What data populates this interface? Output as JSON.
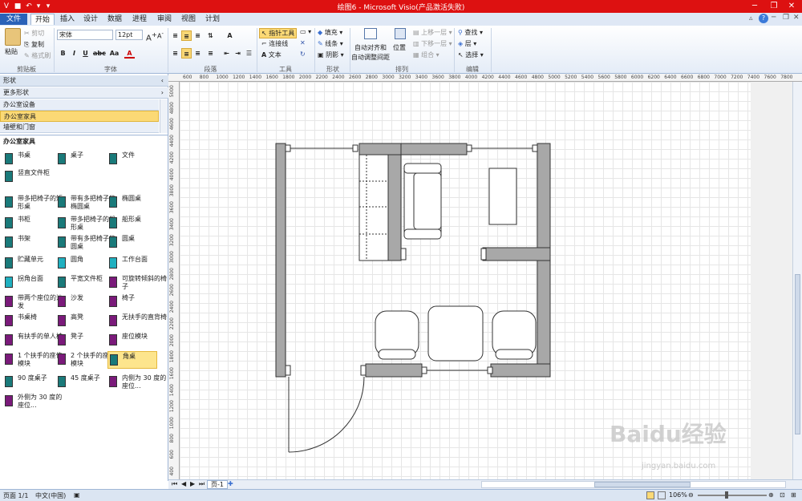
{
  "app": {
    "title": "绘图6 - Microsoft Visio(产品激活失败)"
  },
  "tabs": [
    "文件",
    "开始",
    "插入",
    "设计",
    "数据",
    "进程",
    "审阅",
    "视图",
    "计划"
  ],
  "ribbon": {
    "clipboard": {
      "paste": "粘贴",
      "cut": "剪切",
      "copy": "复制",
      "format_painter": "格式刷",
      "label": "剪贴板"
    },
    "font": {
      "name": "宋体",
      "size": "12pt",
      "label": "字体"
    },
    "paragraph": {
      "label": "段落"
    },
    "tools": {
      "pointer": "指针工具",
      "connector": "连接线",
      "text": "文本",
      "label": "工具"
    },
    "shape": {
      "fill": "填充",
      "line": "线条",
      "shadow": "阴影",
      "label": "形状"
    },
    "arrange": {
      "auto_align": "自动对齐和",
      "auto_space": "自动调整间距",
      "position": "位置",
      "bring_forward": "上移一层",
      "send_backward": "下移一层",
      "group": "组合",
      "label": "排列"
    },
    "editing": {
      "find": "查找",
      "layer": "层",
      "select": "选择",
      "label": "编辑"
    }
  },
  "leftpane": {
    "shapes_header": "形状",
    "more_shapes": "更多形状",
    "stencils": [
      "办公室设备",
      "办公室家具",
      "墙壁和门窗"
    ],
    "section_title": "办公室家具",
    "items": [
      {
        "label": "书桌",
        "color": "#1a7a7a"
      },
      {
        "label": "桌子",
        "color": "#1a7a7a"
      },
      {
        "label": "文件",
        "color": "#1a7a7a"
      },
      {
        "label": "竖直文件柜",
        "color": "#1a7a7a"
      },
      {
        "label": "带多把椅子的矩形桌",
        "color": "#1a7a7a"
      },
      {
        "label": "带有多把椅子的椭圆桌",
        "color": "#1a7a7a"
      },
      {
        "label": "椭圆桌",
        "color": "#1a7a7a"
      },
      {
        "label": "书柜",
        "color": "#1a7a7a"
      },
      {
        "label": "带多把椅子的船形桌",
        "color": "#1a7a7a"
      },
      {
        "label": "船形桌",
        "color": "#1a7a7a"
      },
      {
        "label": "书架",
        "color": "#1a7a7a"
      },
      {
        "label": "带有多把椅子的圆桌",
        "color": "#1a7a7a"
      },
      {
        "label": "圆桌",
        "color": "#1a7a7a"
      },
      {
        "label": "贮藏单元",
        "color": "#1a7a7a"
      },
      {
        "label": "圆角",
        "color": "#20b0c0"
      },
      {
        "label": "工作台面",
        "color": "#20b0c0"
      },
      {
        "label": "拐角台面",
        "color": "#20b0c0"
      },
      {
        "label": "平宽文件柜",
        "color": "#1a7a7a"
      },
      {
        "label": "可旋转倾斜的椅子",
        "color": "#7a1a7a"
      },
      {
        "label": "带两个座位的沙发",
        "color": "#7a1a7a"
      },
      {
        "label": "沙发",
        "color": "#7a1a7a"
      },
      {
        "label": "椅子",
        "color": "#7a1a7a"
      },
      {
        "label": "书桌椅",
        "color": "#7a1a7a"
      },
      {
        "label": "高凳",
        "color": "#7a1a7a"
      },
      {
        "label": "无扶手的直背椅",
        "color": "#7a1a7a"
      },
      {
        "label": "有扶手的单人椅",
        "color": "#7a1a7a"
      },
      {
        "label": "凳子",
        "color": "#7a1a7a"
      },
      {
        "label": "座位模块",
        "color": "#7a1a7a"
      },
      {
        "label": "1 个扶手的座位模块",
        "color": "#7a1a7a"
      },
      {
        "label": "2 个扶手的座位模块",
        "color": "#7a1a7a"
      },
      {
        "label": "角桌",
        "color": "#1a7a7a"
      },
      {
        "label": "90 度桌子",
        "color": "#1a7a7a"
      },
      {
        "label": "45 度桌子",
        "color": "#1a7a7a"
      },
      {
        "label": "内侧为 30 度的座位...",
        "color": "#7a1a7a"
      },
      {
        "label": "外侧为 30 度的座位...",
        "color": "#7a1a7a"
      }
    ]
  },
  "ruler": {
    "h_ticks": [
      "600",
      "800",
      "1000",
      "1200",
      "1400",
      "1600",
      "1800",
      "2000",
      "2200",
      "2400",
      "2600",
      "2800",
      "3000",
      "3200",
      "3400",
      "3600",
      "3800",
      "4000",
      "4200",
      "4400",
      "4600",
      "4800",
      "5000",
      "5200",
      "5400",
      "5600",
      "5800",
      "6000",
      "6200",
      "6400",
      "6600",
      "6800",
      "7000",
      "7200",
      "7400",
      "7600",
      "7800"
    ],
    "v_ticks": [
      "5000",
      "4800",
      "4600",
      "4400",
      "4200",
      "4000",
      "3800",
      "3600",
      "3400",
      "3200",
      "3000",
      "2800",
      "2600",
      "2400",
      "2200",
      "2000",
      "1800",
      "1600",
      "1400",
      "1200",
      "1000",
      "800",
      "600",
      "400"
    ]
  },
  "pagebar": {
    "page_tab": "页-1"
  },
  "status": {
    "page": "页面 1/1",
    "language": "中文(中国)",
    "zoom": "106%"
  },
  "watermark": {
    "main": "Baidu经验",
    "sub": "jingyan.baidu.com"
  },
  "colors": {
    "title_bar": "#dd1111",
    "wall": "#a8a8a8",
    "selection": "#fde58d"
  }
}
